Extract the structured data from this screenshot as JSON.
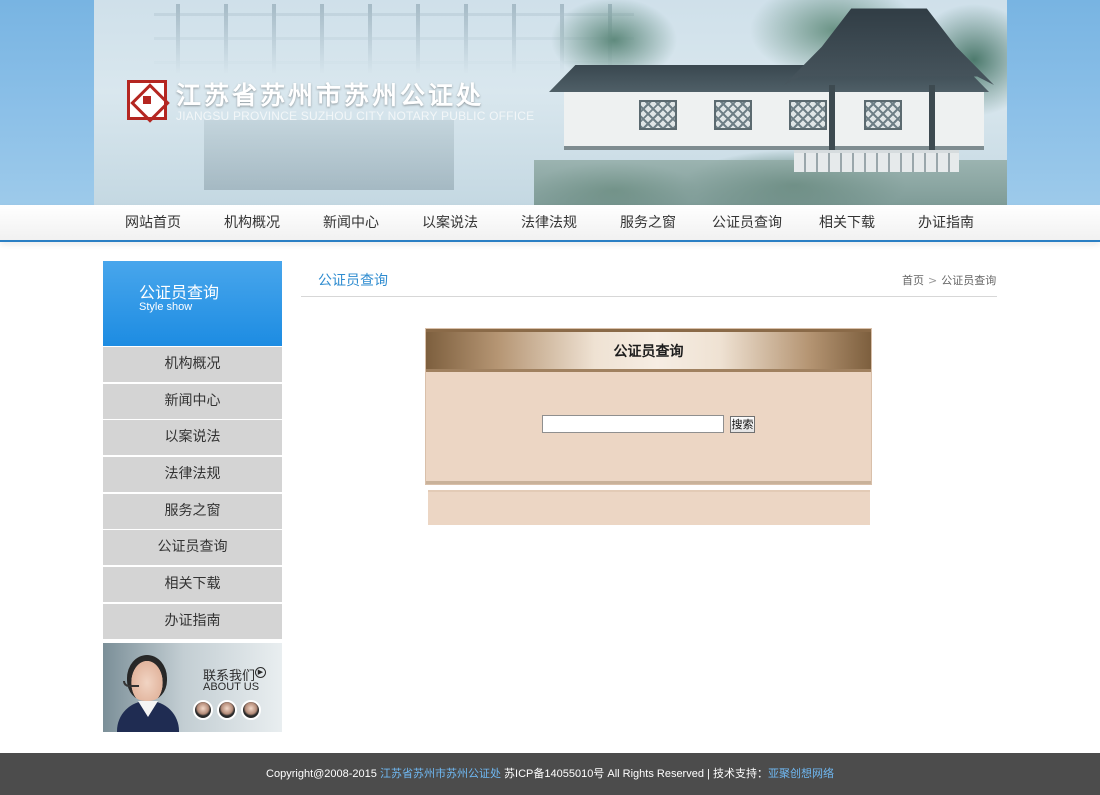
{
  "header": {
    "title": "江苏省苏州市苏州公证处",
    "subtitle": "JIANGSU PROVINCE SUZHOU CITY NOTARY PUBLIC OFFICE"
  },
  "nav": {
    "items": [
      {
        "label": "网站首页"
      },
      {
        "label": "机构概况"
      },
      {
        "label": "新闻中心"
      },
      {
        "label": "以案说法"
      },
      {
        "label": "法律法规"
      },
      {
        "label": "服务之窗"
      },
      {
        "label": "公证员查询"
      },
      {
        "label": "相关下载"
      },
      {
        "label": "办证指南"
      }
    ]
  },
  "sidebar": {
    "title": "公证员查询",
    "subtitle": "Style show",
    "items": [
      {
        "label": "机构概况"
      },
      {
        "label": "新闻中心"
      },
      {
        "label": "以案说法"
      },
      {
        "label": "法律法规"
      },
      {
        "label": "服务之窗"
      },
      {
        "label": "公证员查询"
      },
      {
        "label": "相关下载"
      },
      {
        "label": "办证指南"
      }
    ],
    "contact": {
      "title": "联系我们",
      "subtitle": "ABOUT US"
    }
  },
  "main": {
    "title": "公证员查询",
    "breadcrumb": {
      "home": "首页",
      "separator": ">",
      "current": "公证员查询"
    },
    "query": {
      "title": "公证员查询",
      "input_value": "",
      "search_label": "搜索"
    }
  },
  "footer": {
    "copyright": "Copyright@2008-2015",
    "org_link": "江苏省苏州市苏州公证处",
    "icp": "苏ICP备14055010号 All Rights Reserved",
    "divider": "|",
    "support_label": "技术支持：",
    "support_link": "亚聚创想网络"
  },
  "colors": {
    "accent_blue": "#2a7fc4",
    "sidebar_header": "#1d8ce2",
    "footer_bg": "#4c4c4c",
    "query_panel_bg": "#ecd6c4"
  }
}
